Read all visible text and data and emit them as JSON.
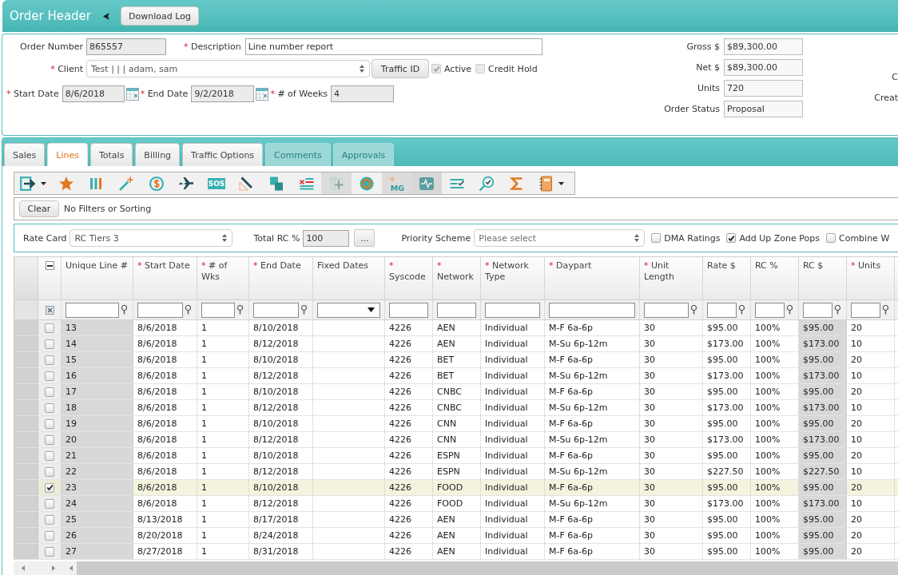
{
  "header": {
    "title": "Order Header",
    "download_button": "Download Log"
  },
  "order": {
    "order_number": {
      "label": "Order Number",
      "value": "865557",
      "readonly": true
    },
    "description": {
      "mark": "*",
      "label": "Description",
      "value": "Line number report",
      "readonly": false
    },
    "client": {
      "mark": "*",
      "label": "Client",
      "value": "Test | | | adam, sam"
    },
    "traffic_id_button": "Traffic ID",
    "flags": [
      {
        "label": "Active",
        "checked": true,
        "disabled": true
      },
      {
        "label": "Credit Hold",
        "checked": false,
        "disabled": true
      }
    ],
    "start_date": {
      "mark": "*",
      "label": "Start Date",
      "value": "8/6/2018",
      "readonly": true
    },
    "end_date": {
      "mark": "*",
      "label": "End Date",
      "value": "9/2/2018",
      "readonly": true
    },
    "weeks": {
      "mark": "*",
      "label": "# of Weeks",
      "value": "4",
      "readonly": true
    },
    "totals": [
      {
        "label": "Gross $",
        "value": "$89,300.00"
      },
      {
        "label": "Net $",
        "value": "$89,300.00"
      },
      {
        "label": "Units",
        "value": "720"
      },
      {
        "label": "Order Status",
        "value": "Proposal"
      }
    ],
    "cut_labels": [
      "C",
      "Creat"
    ]
  },
  "tabs": [
    {
      "label": "Sales",
      "selected": false,
      "disabled": false
    },
    {
      "label": "Lines",
      "selected": true,
      "disabled": false
    },
    {
      "label": "Totals",
      "selected": false,
      "disabled": false
    },
    {
      "label": "Billing",
      "selected": false,
      "disabled": false
    },
    {
      "label": "Traffic Options",
      "selected": false,
      "disabled": false
    },
    {
      "label": "Comments",
      "selected": false,
      "disabled": true
    },
    {
      "label": "Approvals",
      "selected": false,
      "disabled": true
    }
  ],
  "toolbar": [
    {
      "kind": "export",
      "dropdown": true,
      "disabled": false,
      "pressed": false
    },
    {
      "kind": "star",
      "dropdown": false,
      "disabled": false,
      "pressed": false
    },
    {
      "kind": "columns",
      "dropdown": false,
      "disabled": false,
      "pressed": false
    },
    {
      "kind": "wand",
      "dropdown": false,
      "disabled": false,
      "pressed": false
    },
    {
      "kind": "dollar",
      "dropdown": false,
      "disabled": false,
      "pressed": false
    },
    {
      "kind": "plane",
      "dropdown": false,
      "disabled": false,
      "pressed": false
    },
    {
      "kind": "sos",
      "label": "SOS",
      "dropdown": false,
      "disabled": false,
      "pressed": false
    },
    {
      "kind": "pencil",
      "dropdown": false,
      "disabled": false,
      "pressed": false
    },
    {
      "kind": "copy",
      "dropdown": false,
      "disabled": false,
      "pressed": false
    },
    {
      "kind": "remove",
      "dropdown": false,
      "disabled": false,
      "pressed": false
    },
    {
      "kind": "addgrid",
      "dropdown": false,
      "disabled": true,
      "pressed": false
    },
    {
      "kind": "ring",
      "dropdown": false,
      "disabled": false,
      "pressed": false
    },
    {
      "kind": "mg",
      "label": "MG",
      "dropdown": false,
      "disabled": true,
      "pressed": false
    },
    {
      "kind": "pulse",
      "dropdown": false,
      "disabled": false,
      "pressed": true
    },
    {
      "kind": "checklist",
      "dropdown": false,
      "disabled": false,
      "pressed": false
    },
    {
      "kind": "inspect",
      "dropdown": false,
      "disabled": false,
      "pressed": false
    },
    {
      "kind": "sigma",
      "dropdown": false,
      "disabled": false,
      "pressed": false
    },
    {
      "kind": "notebook",
      "dropdown": true,
      "disabled": false,
      "pressed": false
    }
  ],
  "filter_bar": {
    "clear_button": "Clear",
    "status": "No Filters or Sorting"
  },
  "rate_bar": {
    "rate_card": {
      "label": "Rate Card",
      "value": "RC Tiers 3"
    },
    "total_rc": {
      "label": "Total RC %",
      "value": "100",
      "readonly": true
    },
    "more_button": "...",
    "priority_scheme": {
      "label": "Priority Scheme",
      "placeholder": "Please select"
    },
    "options": [
      {
        "label": "DMA Ratings",
        "checked": false
      },
      {
        "label": "Add Up Zone Pops",
        "checked": true
      },
      {
        "label": "Combine W",
        "checked": false
      }
    ]
  },
  "grid": {
    "select_all": {
      "indeterminate": true
    },
    "columns": [
      {
        "label": "Unique Line #",
        "readonly": true
      },
      {
        "mark": "*",
        "label": "Start Date",
        "readonly": false
      },
      {
        "mark": "*",
        "label": "# of Wks",
        "readonly": false
      },
      {
        "mark": "*",
        "label": "End Date",
        "readonly": false
      },
      {
        "label": "Fixed Dates",
        "readonly": false
      },
      {
        "mark": "*",
        "label": "Syscode",
        "readonly": false
      },
      {
        "mark": "*",
        "label": "Network",
        "readonly": false
      },
      {
        "mark": "*",
        "label": "Network Type",
        "readonly": false
      },
      {
        "mark": "*",
        "label": "Daypart",
        "readonly": false
      },
      {
        "mark": "*",
        "label": "Unit Length",
        "readonly": false
      },
      {
        "label": "Rate $",
        "readonly": false
      },
      {
        "label": "RC %",
        "readonly": false
      },
      {
        "label": "RC $",
        "readonly": true
      },
      {
        "mark": "*",
        "label": "Units",
        "readonly": false
      }
    ],
    "filters": [
      {
        "kind": "funnel"
      },
      {
        "kind": "funnel"
      },
      {
        "kind": "funnel"
      },
      {
        "kind": "funnel"
      },
      {
        "kind": "dropdown"
      },
      {
        "kind": "plain"
      },
      {
        "kind": "plain"
      },
      {
        "kind": "plain"
      },
      {
        "kind": "plain"
      },
      {
        "kind": "funnel"
      },
      {
        "kind": "funnel"
      },
      {
        "kind": "funnel"
      },
      {
        "kind": "funnel"
      },
      {
        "kind": "funnel"
      }
    ],
    "rows": [
      {
        "selected": false,
        "line": "13",
        "start_date": "8/6/2018",
        "weeks": "1",
        "end_date": "8/10/2018",
        "syscode": "4226",
        "network": "AEN",
        "network_type": "Individual",
        "daypart": "M-F 6a-6p",
        "unit_length": "30",
        "rate": "$95.00",
        "rc_percent": "100%",
        "rc": "$95.00",
        "units": "20"
      },
      {
        "selected": false,
        "line": "14",
        "start_date": "8/6/2018",
        "weeks": "1",
        "end_date": "8/12/2018",
        "syscode": "4226",
        "network": "AEN",
        "network_type": "Individual",
        "daypart": "M-Su 6p-12m",
        "unit_length": "30",
        "rate": "$173.00",
        "rc_percent": "100%",
        "rc": "$173.00",
        "units": "10"
      },
      {
        "selected": false,
        "line": "15",
        "start_date": "8/6/2018",
        "weeks": "1",
        "end_date": "8/10/2018",
        "syscode": "4226",
        "network": "BET",
        "network_type": "Individual",
        "daypart": "M-F 6a-6p",
        "unit_length": "30",
        "rate": "$95.00",
        "rc_percent": "100%",
        "rc": "$95.00",
        "units": "20"
      },
      {
        "selected": false,
        "line": "16",
        "start_date": "8/6/2018",
        "weeks": "1",
        "end_date": "8/12/2018",
        "syscode": "4226",
        "network": "BET",
        "network_type": "Individual",
        "daypart": "M-Su 6p-12m",
        "unit_length": "30",
        "rate": "$173.00",
        "rc_percent": "100%",
        "rc": "$173.00",
        "units": "10"
      },
      {
        "selected": false,
        "line": "17",
        "start_date": "8/6/2018",
        "weeks": "1",
        "end_date": "8/10/2018",
        "syscode": "4226",
        "network": "CNBC",
        "network_type": "Individual",
        "daypart": "M-F 6a-6p",
        "unit_length": "30",
        "rate": "$95.00",
        "rc_percent": "100%",
        "rc": "$95.00",
        "units": "20"
      },
      {
        "selected": false,
        "line": "18",
        "start_date": "8/6/2018",
        "weeks": "1",
        "end_date": "8/12/2018",
        "syscode": "4226",
        "network": "CNBC",
        "network_type": "Individual",
        "daypart": "M-Su 6p-12m",
        "unit_length": "30",
        "rate": "$173.00",
        "rc_percent": "100%",
        "rc": "$173.00",
        "units": "10"
      },
      {
        "selected": false,
        "line": "19",
        "start_date": "8/6/2018",
        "weeks": "1",
        "end_date": "8/10/2018",
        "syscode": "4226",
        "network": "CNN",
        "network_type": "Individual",
        "daypart": "M-F 6a-6p",
        "unit_length": "30",
        "rate": "$95.00",
        "rc_percent": "100%",
        "rc": "$95.00",
        "units": "20"
      },
      {
        "selected": false,
        "line": "20",
        "start_date": "8/6/2018",
        "weeks": "1",
        "end_date": "8/12/2018",
        "syscode": "4226",
        "network": "CNN",
        "network_type": "Individual",
        "daypart": "M-Su 6p-12m",
        "unit_length": "30",
        "rate": "$173.00",
        "rc_percent": "100%",
        "rc": "$173.00",
        "units": "10"
      },
      {
        "selected": false,
        "line": "21",
        "start_date": "8/6/2018",
        "weeks": "1",
        "end_date": "8/10/2018",
        "syscode": "4226",
        "network": "ESPN",
        "network_type": "Individual",
        "daypart": "M-F 6a-6p",
        "unit_length": "30",
        "rate": "$95.00",
        "rc_percent": "100%",
        "rc": "$95.00",
        "units": "20"
      },
      {
        "selected": false,
        "line": "22",
        "start_date": "8/6/2018",
        "weeks": "1",
        "end_date": "8/12/2018",
        "syscode": "4226",
        "network": "ESPN",
        "network_type": "Individual",
        "daypart": "M-Su 6p-12m",
        "unit_length": "30",
        "rate": "$227.50",
        "rc_percent": "100%",
        "rc": "$227.50",
        "units": "10"
      },
      {
        "selected": true,
        "line": "23",
        "start_date": "8/6/2018",
        "weeks": "1",
        "end_date": "8/10/2018",
        "syscode": "4226",
        "network": "FOOD",
        "network_type": "Individual",
        "daypart": "M-F 6a-6p",
        "unit_length": "30",
        "rate": "$95.00",
        "rc_percent": "100%",
        "rc": "$95.00",
        "units": "20"
      },
      {
        "selected": false,
        "line": "24",
        "start_date": "8/6/2018",
        "weeks": "1",
        "end_date": "8/12/2018",
        "syscode": "4226",
        "network": "FOOD",
        "network_type": "Individual",
        "daypart": "M-Su 6p-12m",
        "unit_length": "30",
        "rate": "$173.00",
        "rc_percent": "100%",
        "rc": "$173.00",
        "units": "10"
      },
      {
        "selected": false,
        "line": "25",
        "start_date": "8/13/2018",
        "weeks": "1",
        "end_date": "8/17/2018",
        "syscode": "4226",
        "network": "AEN",
        "network_type": "Individual",
        "daypart": "M-F 6a-6p",
        "unit_length": "30",
        "rate": "$95.00",
        "rc_percent": "100%",
        "rc": "$95.00",
        "units": "20"
      },
      {
        "selected": false,
        "line": "26",
        "start_date": "8/20/2018",
        "weeks": "1",
        "end_date": "8/24/2018",
        "syscode": "4226",
        "network": "AEN",
        "network_type": "Individual",
        "daypart": "M-F 6a-6p",
        "unit_length": "30",
        "rate": "$95.00",
        "rc_percent": "100%",
        "rc": "$95.00",
        "units": "20"
      },
      {
        "selected": false,
        "line": "27",
        "start_date": "8/27/2018",
        "weeks": "1",
        "end_date": "8/31/2018",
        "syscode": "4226",
        "network": "AEN",
        "network_type": "Individual",
        "daypart": "M-F 6a-6p",
        "unit_length": "30",
        "rate": "$95.00",
        "rc_percent": "100%",
        "rc": "$95.00",
        "units": "20"
      }
    ]
  }
}
